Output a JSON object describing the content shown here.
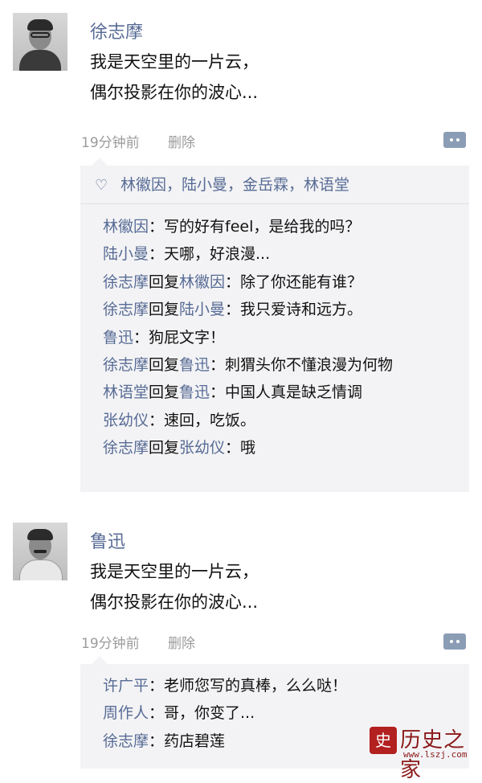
{
  "posts": [
    {
      "author": "徐志摩",
      "content_lines": [
        "我是天空里的一片云，",
        "偶尔投影在你的波心..."
      ],
      "time": "19分钟前",
      "delete_label": "删除",
      "likes": "林徽因，陆小曼，金岳霖，林语堂",
      "comments": [
        {
          "author": "林徽因",
          "reply_label": "",
          "target": "",
          "text": "：写的好有feel，是给我的吗？"
        },
        {
          "author": "陆小曼",
          "reply_label": "",
          "target": "",
          "text": "：天哪，好浪漫..."
        },
        {
          "author": "徐志摩",
          "reply_label": "回复",
          "target": "林徽因",
          "text": "：除了你还能有谁？"
        },
        {
          "author": "徐志摩",
          "reply_label": "回复",
          "target": "陆小曼",
          "text": "：我只爱诗和远方。"
        },
        {
          "author": "鲁迅",
          "reply_label": "",
          "target": "",
          "text": "：狗屁文字！"
        },
        {
          "author": "徐志摩",
          "reply_label": "回复",
          "target": "鲁迅",
          "text": "：刺猬头你不懂浪漫为何物"
        },
        {
          "author": "林语堂",
          "reply_label": "回复",
          "target": "鲁迅",
          "text": "：中国人真是缺乏情调"
        },
        {
          "author": "张幼仪",
          "reply_label": "",
          "target": "",
          "text": "：速回，吃饭。"
        },
        {
          "author": "徐志摩",
          "reply_label": "回复",
          "target": "张幼仪",
          "text": "：哦"
        }
      ]
    },
    {
      "author": "鲁迅",
      "content_lines": [
        "我是天空里的一片云，",
        "偶尔投影在你的波心..."
      ],
      "time": "19分钟前",
      "delete_label": "删除",
      "comments": [
        {
          "author": "许广平",
          "reply_label": "",
          "target": "",
          "text": "：老师您写的真棒，么么哒！"
        },
        {
          "author": "周作人",
          "reply_label": "",
          "target": "",
          "text": "：哥，你变了..."
        },
        {
          "author": "徐志摩",
          "reply_label": "",
          "target": "",
          "text": "：药店碧莲"
        }
      ]
    }
  ],
  "watermark": {
    "seal": "史",
    "name": "历史之家",
    "url": "www.lszj.com"
  },
  "colors": {
    "link": "#576b95",
    "panel": "#f3f3f5",
    "meta": "#9b9b9b"
  }
}
